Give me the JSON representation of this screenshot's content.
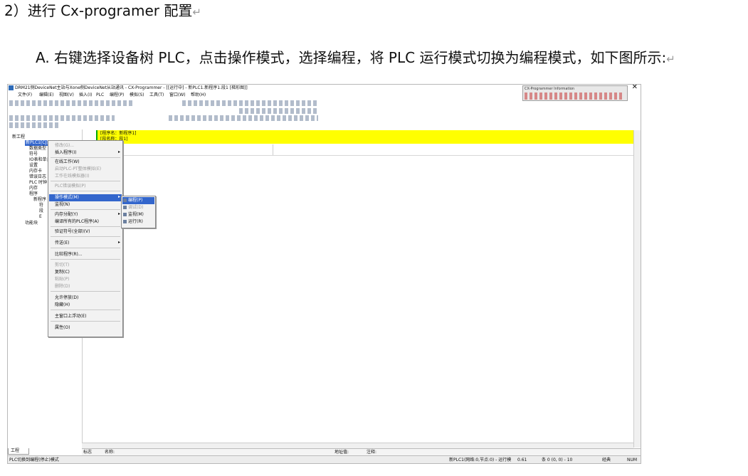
{
  "doc": {
    "heading": "2）进行 Cx-programer 配置",
    "paragraph": "A. 右键选择设备树 PLC，点击操作模式，选择编程，将 PLC 运行模式切换为编程模式，如下图所示:",
    "mark": "↵"
  },
  "app": {
    "title": "DRM21侧DeviceNet主站与Xone侧DeviceNet从站通讯 - CX-Programmer - [[运行中] - 新PLC1.新程序1.段1 [梯形图]]",
    "info_panel_title": "CX-Programmer Information",
    "close": "✕",
    "menu": [
      "文件(F)",
      "编辑(E)",
      "视图(V)",
      "插入(I)",
      "PLC",
      "编程(P)",
      "模拟(S)",
      "工具(T)",
      "窗口(W)",
      "帮助(H)"
    ]
  },
  "tree": {
    "items": [
      "新工程",
      "新PLC1[CJ]",
      "数据类型",
      "符号",
      "IO表和单元",
      "设置",
      "内存卡",
      "错误日志",
      "PLC 时钟",
      "内存",
      "程序",
      "新程序",
      "符",
      "段",
      "E",
      "功能块"
    ],
    "tab": "工程"
  },
  "ladder": {
    "label1": "[程序名：新程序1]",
    "label2": "[段名称：段1]"
  },
  "context_menu": {
    "items": [
      {
        "label": "修改(G)...",
        "disabled": true
      },
      {
        "label": "插入程序(I)",
        "submenu": true
      },
      {
        "label": "在线工作(W)"
      },
      {
        "label": "启动PLC-PT整体模拟(E)",
        "disabled": true
      },
      {
        "label": "工作在线模拟器(I)",
        "disabled": true
      },
      {
        "label": "PLC错误模拟(P)",
        "disabled": true
      },
      {
        "label": "操作模式(M)",
        "submenu": true,
        "highlight": true
      },
      {
        "label": "监视(N)"
      },
      {
        "label": "内存分配(Y)",
        "submenu": true
      },
      {
        "label": "编译所有的PLC程序(A)"
      },
      {
        "label": "验证符号(全部)(V)"
      },
      {
        "label": "传送(E)",
        "submenu": true
      },
      {
        "label": "比较程序(R)..."
      },
      {
        "label": "剪切(T)",
        "disabled": true
      },
      {
        "label": "复制(C)"
      },
      {
        "label": "粘贴(P)",
        "disabled": true
      },
      {
        "label": "删除(D)",
        "disabled": true
      },
      {
        "label": "允许停放(D)"
      },
      {
        "label": "隐藏(H)"
      },
      {
        "label": "主窗口上浮动(E)"
      },
      {
        "label": "属性(O)"
      }
    ]
  },
  "submenu": {
    "items": [
      {
        "label": "编程(P)",
        "highlight": true
      },
      {
        "label": "调试(D)",
        "disabled": true
      },
      {
        "label": "监视(M)"
      },
      {
        "label": "运行(R)"
      }
    ]
  },
  "fields": {
    "id": "标志",
    "name": "名称:",
    "addr": "地址值:",
    "comment": "注释:"
  },
  "status": {
    "left": "PLC切换到编程(停止)模式",
    "plc": "新PLC1(网络:0,节点:0) - 运行模",
    "v1": "0.61",
    "pos": "条 0 (0, 0) - 10",
    "mode": "经典",
    "num": "NUM"
  }
}
